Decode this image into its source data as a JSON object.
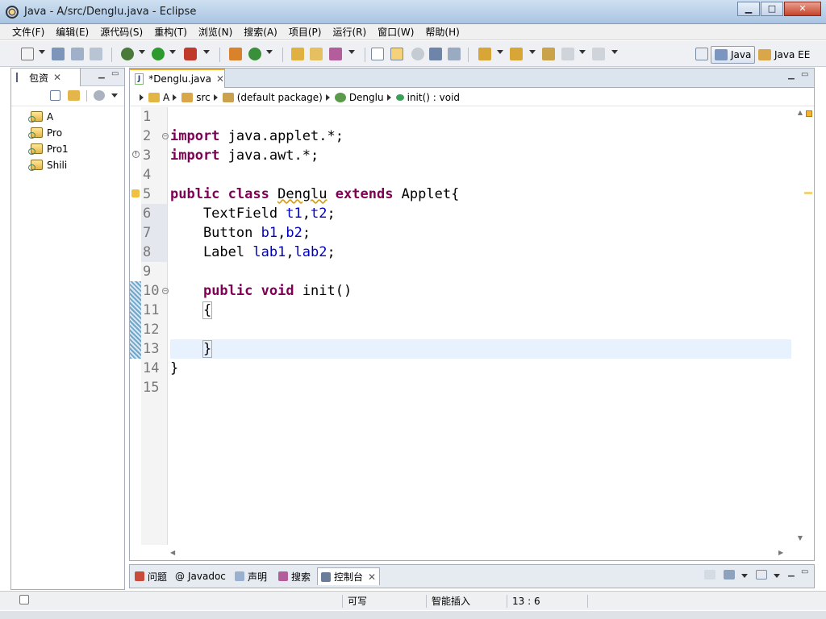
{
  "window": {
    "title": "Java  -  A/src/Denglu.java  -  Eclipse",
    "controls": {
      "minimize": "▁",
      "maximize": "□",
      "close": "✕"
    }
  },
  "menu": [
    "文件(F)",
    "编辑(E)",
    "源代码(S)",
    "重构(T)",
    "浏览(N)",
    "搜索(A)",
    "项目(P)",
    "运行(R)",
    "窗口(W)",
    "帮助(H)"
  ],
  "perspectives": [
    {
      "label": "Java",
      "active": true
    },
    {
      "label": "Java EE",
      "active": false
    }
  ],
  "package_explorer": {
    "tab_label": "包资",
    "close": "✕",
    "projects": [
      "A",
      "Pro",
      "Pro1",
      "Shili"
    ]
  },
  "editor": {
    "tab_label": "*Denglu.java",
    "close": "✕",
    "breadcrumb": [
      "A",
      "src",
      "(default package)",
      "Denglu",
      "init() : void"
    ],
    "line_numbers": [
      "1",
      "2",
      "3",
      "4",
      "5",
      "6",
      "7",
      "8",
      "9",
      "10",
      "11",
      "12",
      "13",
      "14",
      "15"
    ],
    "current_line": 13
  },
  "bottom_tabs": [
    {
      "label": "问题",
      "active": false
    },
    {
      "label": "Javadoc",
      "active": false
    },
    {
      "label": "声明",
      "active": false
    },
    {
      "label": "搜索",
      "active": false
    },
    {
      "label": "控制台",
      "active": true
    }
  ],
  "status": {
    "writable": "可写",
    "insert_mode": "智能插入",
    "position": "13 : 6"
  },
  "colors": {
    "keyword": "#7f0055",
    "field": "#0000c0",
    "current_line": "#e8f2fe"
  }
}
